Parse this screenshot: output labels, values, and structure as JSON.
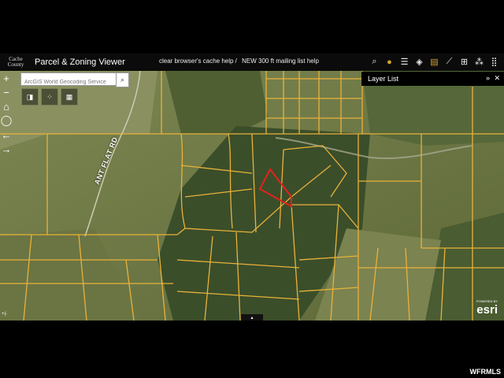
{
  "header": {
    "logo_line1": "Cache",
    "logo_line2": "County",
    "title": "Parcel & Zoning Viewer",
    "link1": "clear browser's cache help /",
    "link2": "NEW 300 ft mailing list help"
  },
  "toolbar": [
    {
      "icon": "search-icon",
      "glyph": "⌕"
    },
    {
      "icon": "basemap-icon",
      "glyph": "●"
    },
    {
      "icon": "legend-icon",
      "glyph": "☰"
    },
    {
      "icon": "layers-icon",
      "glyph": "◈"
    },
    {
      "icon": "map-icon",
      "glyph": "▤"
    },
    {
      "icon": "measure-icon",
      "glyph": "⟋"
    },
    {
      "icon": "grid-icon",
      "glyph": "⊞"
    },
    {
      "icon": "share-icon",
      "glyph": "⁂"
    },
    {
      "icon": "apps-icon",
      "glyph": "⣿"
    }
  ],
  "search": {
    "placeholder": "ArcGIS World Geocoding Service",
    "button_glyph": "⌕"
  },
  "zoom": {
    "in": "+",
    "out": "−",
    "home": "⌂",
    "locate": "◯",
    "back": "←",
    "forward": "→"
  },
  "widgets": [
    {
      "icon": "bookmark-icon",
      "glyph": "◨"
    },
    {
      "icon": "draw-icon",
      "glyph": "⁘"
    },
    {
      "icon": "print-icon",
      "glyph": "▦"
    }
  ],
  "layer_list": {
    "title": "Layer List",
    "collapse": "»",
    "close": "✕"
  },
  "map": {
    "road_label": "ANT FLAT RD",
    "attribution_handle": "▴",
    "coords_icon": "+|-",
    "esri_powered": "POWERED BY",
    "esri_logo": "esri"
  },
  "watermark": "WFRMLS",
  "colors": {
    "parcel_line": "#e9b23a",
    "selected_parcel": "#e3221d",
    "terrain": "#6f7746",
    "forest": "#2f4224"
  }
}
